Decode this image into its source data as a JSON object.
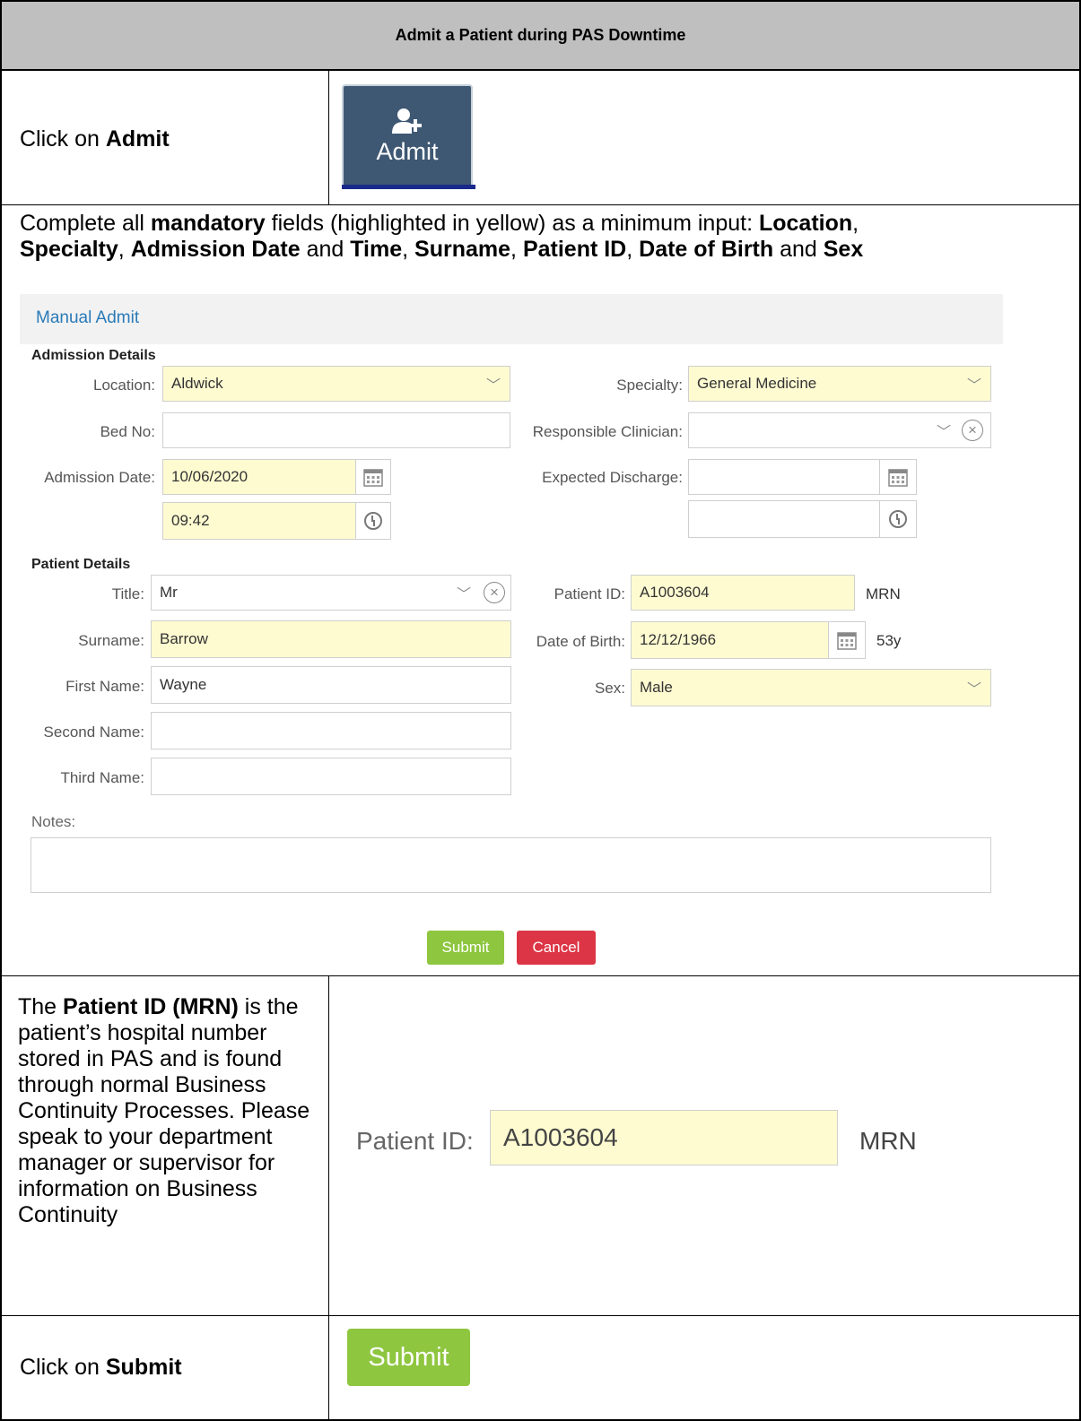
{
  "header": {
    "title": "Admit a Patient during PAS Downtime"
  },
  "step1": {
    "text_prefix": "Click on ",
    "text_bold": "Admit",
    "button_label": "Admit"
  },
  "step2": {
    "line1_parts": [
      "Complete all ",
      "mandatory",
      " fields (highlighted in yellow) as a minimum input: ",
      "Location",
      ","
    ],
    "line2_parts": [
      "Specialty",
      ", ",
      "Admission Date",
      " and ",
      "Time",
      ", ",
      "Surname",
      ", ",
      "Patient ID",
      ", ",
      "Date of Birth",
      " and ",
      "Sex"
    ]
  },
  "form": {
    "title": "Manual Admit",
    "admission_section": "Admission Details",
    "location_label": "Location:",
    "location_value": "Aldwick",
    "specialty_label": "Specialty:",
    "specialty_value": "General Medicine",
    "bed_label": "Bed No:",
    "bed_value": "",
    "clinician_label": "Responsible Clinician:",
    "clinician_value": "",
    "admission_date_label": "Admission Date:",
    "admission_date_value": "10/06/2020",
    "admission_time_value": "09:42",
    "expected_discharge_label": "Expected Discharge:",
    "expected_discharge_value": "",
    "expected_discharge_time": "",
    "patient_section": "Patient Details",
    "title_label": "Title:",
    "title_value": "Mr",
    "patient_id_label": "Patient ID:",
    "patient_id_value": "A1003604",
    "patient_id_suffix": "MRN",
    "surname_label": "Surname:",
    "surname_value": "Barrow",
    "dob_label": "Date of Birth:",
    "dob_value": "12/12/1966",
    "age": "53y",
    "first_name_label": "First Name:",
    "first_name_value": "Wayne",
    "sex_label": "Sex:",
    "sex_value": "Male",
    "second_name_label": "Second Name:",
    "second_name_value": "",
    "third_name_label": "Third Name:",
    "third_name_value": "",
    "notes_label": "Notes:",
    "notes_value": "",
    "submit_label": "Submit",
    "cancel_label": "Cancel"
  },
  "step3": {
    "text_parts": [
      "The ",
      "Patient ID (MRN)",
      " is the patient’s hospital number stored in PAS and is found through normal Business Continuity Processes. Please speak to your department manager or supervisor for information on Business Continuity"
    ],
    "field_label": "Patient ID:",
    "field_value": "A1003604",
    "field_suffix": "MRN"
  },
  "step4": {
    "text_prefix": "Click on ",
    "text_bold": "Submit",
    "button_label": "Submit"
  },
  "colors": {
    "header_bg": "#bfbfbf",
    "mandatory": "#fefbd1",
    "submit": "#8ec63f",
    "cancel": "#dc3545",
    "admit_button": "#3e5873"
  },
  "icons": [
    "user-plus-icon",
    "chevron-down-icon",
    "calendar-icon",
    "clock-icon",
    "clear-circle-icon"
  ]
}
